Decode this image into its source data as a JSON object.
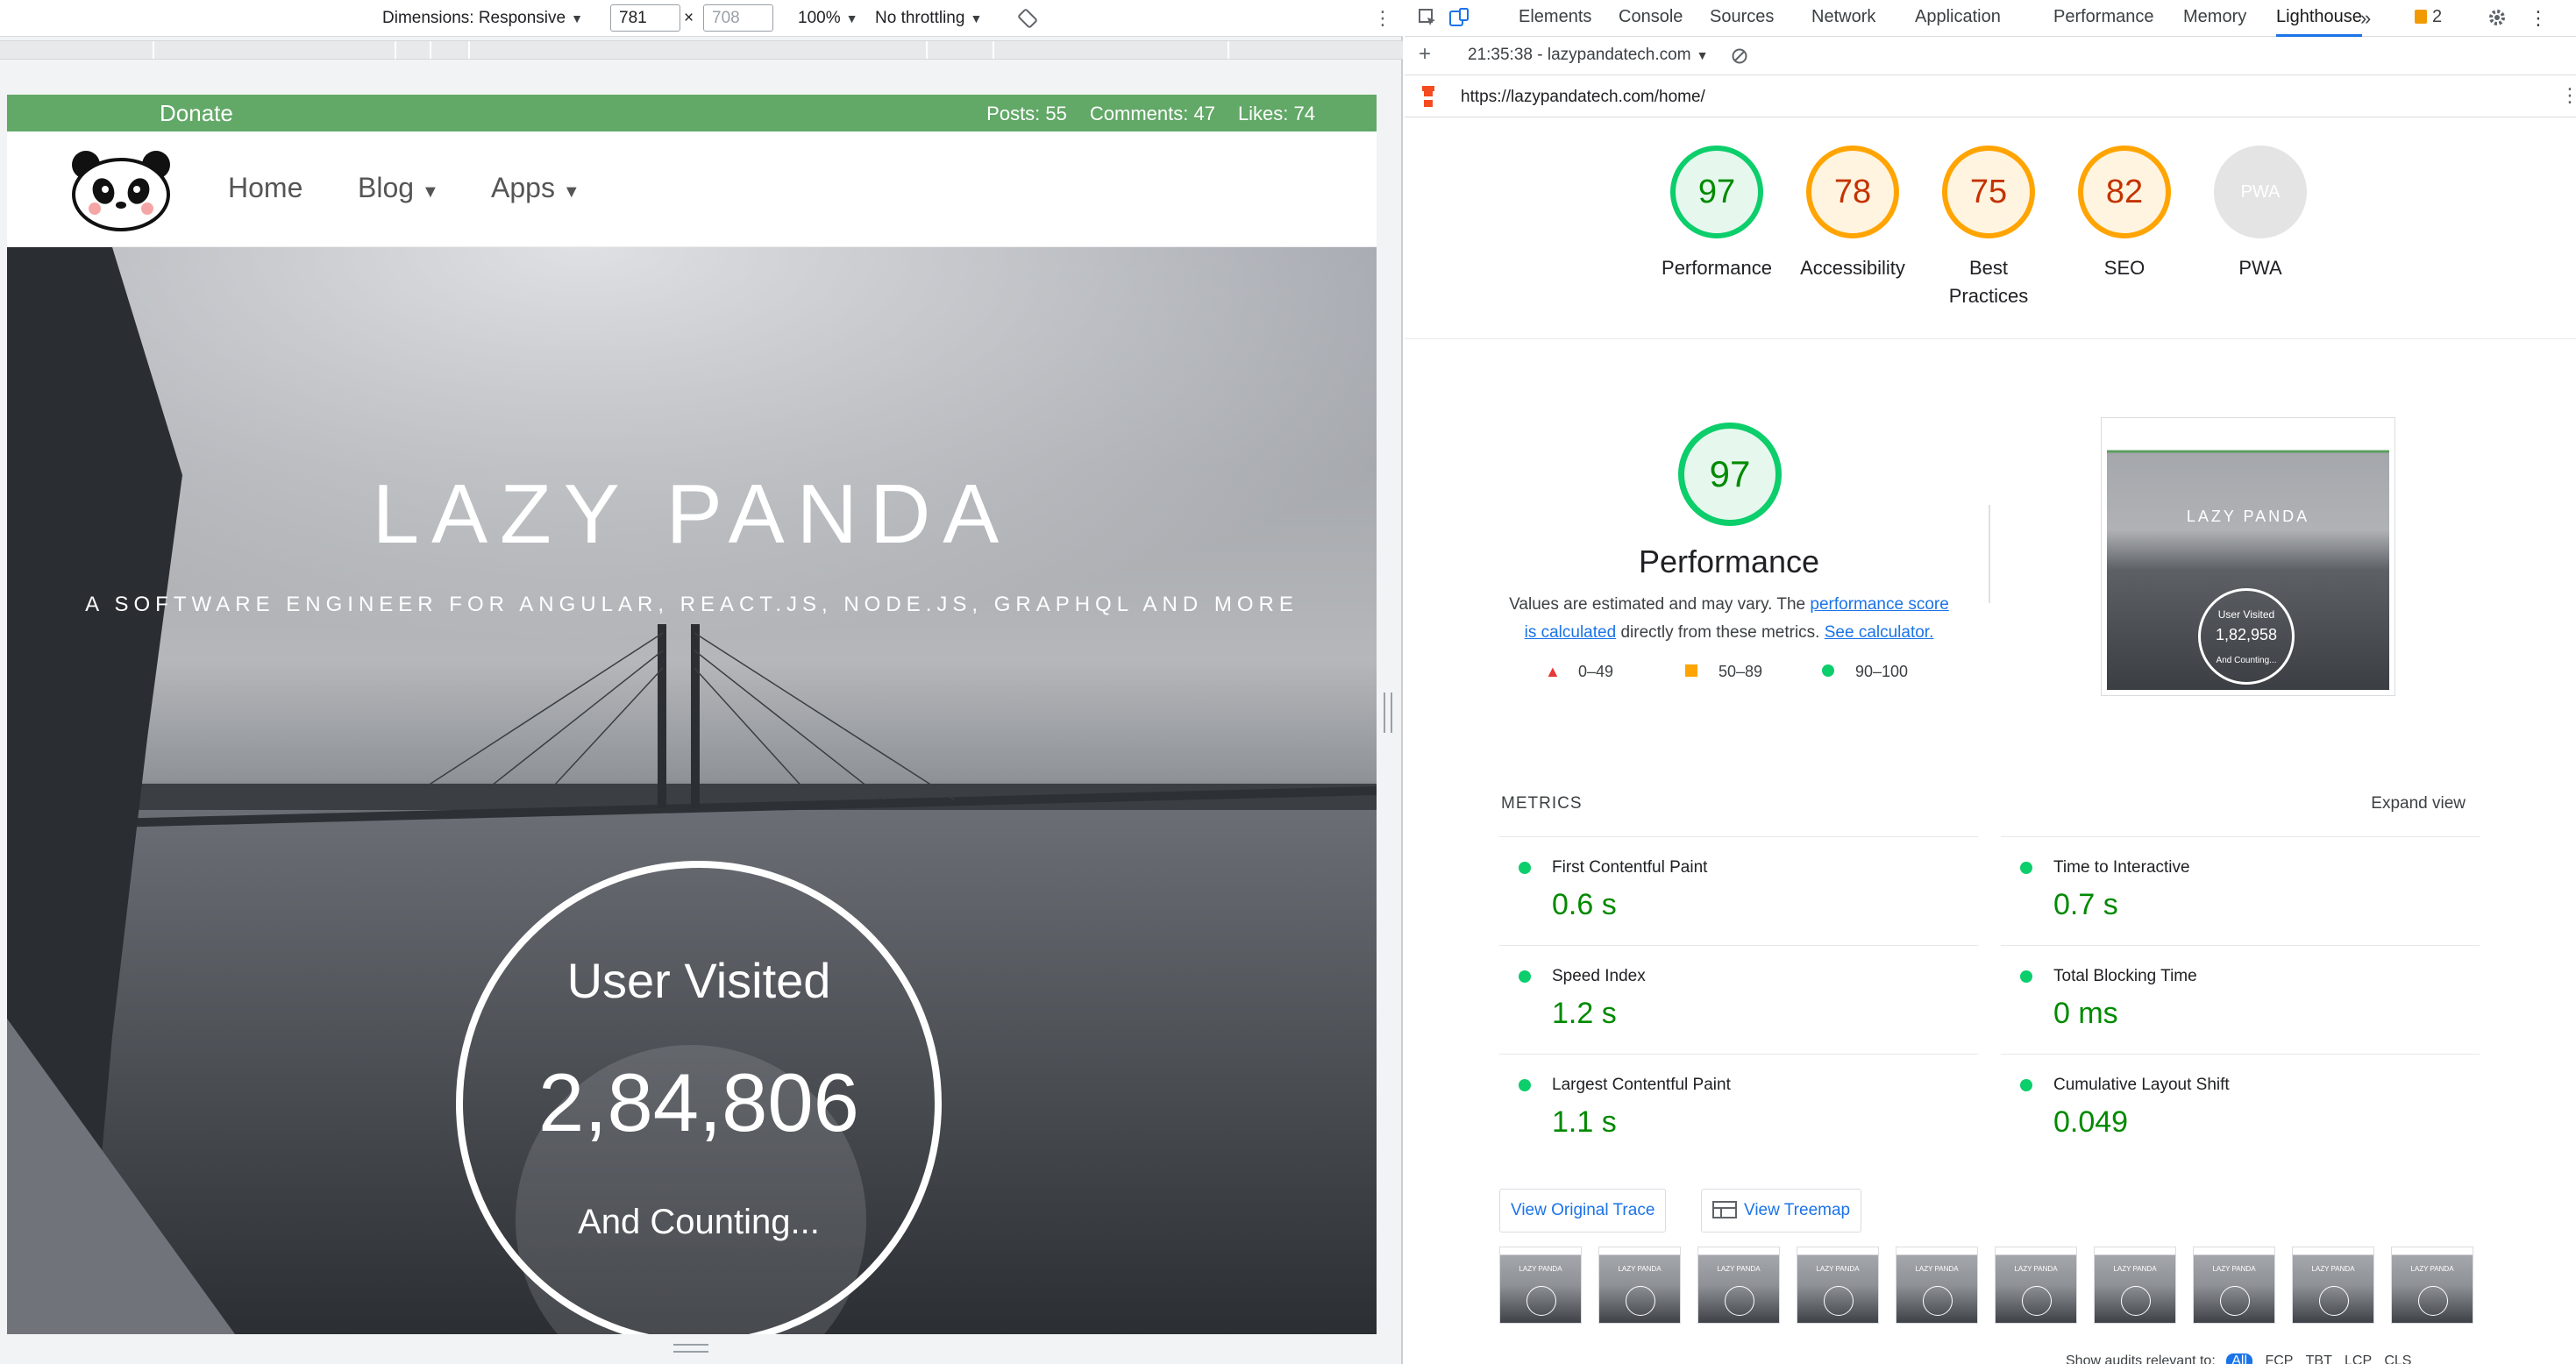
{
  "device_toolbar": {
    "dimensions_label": "Dimensions: Responsive",
    "width_value": "781",
    "times": "×",
    "height_value": "708",
    "zoom": "100%",
    "throttling": "No throttling",
    "more_icon": "vertical-dots-icon",
    "rotate_icon": "rotate-icon"
  },
  "site": {
    "donate": "Donate",
    "stats": {
      "posts": "Posts: 55",
      "comments": "Comments: 47",
      "likes": "Likes: 74"
    },
    "nav": {
      "home": "Home",
      "blog": "Blog",
      "apps": "Apps"
    },
    "hero": {
      "title": "LAZY PANDA",
      "subtitle": "A SOFTWARE ENGINEER FOR ANGULAR, REACT.JS, NODE.JS, GRAPHQL AND MORE",
      "visit_label": "User Visited",
      "visit_count": "2,84,806",
      "visit_sub": "And Counting..."
    }
  },
  "devtools": {
    "tabs": [
      "Elements",
      "Console",
      "Sources",
      "Network",
      "Application",
      "Performance",
      "Memory",
      "Lighthouse"
    ],
    "active_tab": "Lighthouse",
    "more_tabs": "»",
    "issues_count": "2",
    "report_selector": "21:35:38 - lazypandatech.com",
    "add_icon": "+",
    "url": "https://lazypandatech.com/home/"
  },
  "lighthouse": {
    "scores": [
      {
        "label": "Performance",
        "value": "97",
        "status": "pass"
      },
      {
        "label": "Accessibility",
        "value": "78",
        "status": "average"
      },
      {
        "label": "Best Practices",
        "value": "75",
        "status": "average"
      },
      {
        "label": "SEO",
        "value": "82",
        "status": "average"
      },
      {
        "label": "PWA",
        "value": "PWA",
        "status": "na"
      }
    ],
    "perf_score": "97",
    "perf_title": "Performance",
    "perf_desc_before": "Values are estimated and may vary. The ",
    "perf_desc_link1": "performance score is calculated",
    "perf_desc_middle": " directly from these metrics. ",
    "perf_desc_link2": "See calculator.",
    "legend": {
      "fail": "0–49",
      "average": "50–89",
      "pass": "90–100"
    },
    "screenshot": {
      "title": "LAZY PANDA",
      "visit_label": "User Visited",
      "visit_count": "1,82,958",
      "visit_sub": "And Counting..."
    },
    "metrics_title": "METRICS",
    "expand_view": "Expand view",
    "metrics": [
      {
        "name": "First Contentful Paint",
        "value": "0.6 s"
      },
      {
        "name": "Time to Interactive",
        "value": "0.7 s"
      },
      {
        "name": "Speed Index",
        "value": "1.2 s"
      },
      {
        "name": "Total Blocking Time",
        "value": "0 ms"
      },
      {
        "name": "Largest Contentful Paint",
        "value": "1.1 s"
      },
      {
        "name": "Cumulative Layout Shift",
        "value": "0.049"
      }
    ],
    "view_trace": "View Original Trace",
    "view_treemap": "View Treemap",
    "filmstrip_label": "LAZY PANDA",
    "audits_footer": "Show audits relevant to:",
    "audits_filters": [
      "All",
      "FCP",
      "TBT",
      "LCP",
      "CLS"
    ],
    "colors": {
      "pass": "#0cce6b",
      "average": "#ffa400",
      "fail": "#ff4e42",
      "link": "#1a73e8"
    }
  }
}
